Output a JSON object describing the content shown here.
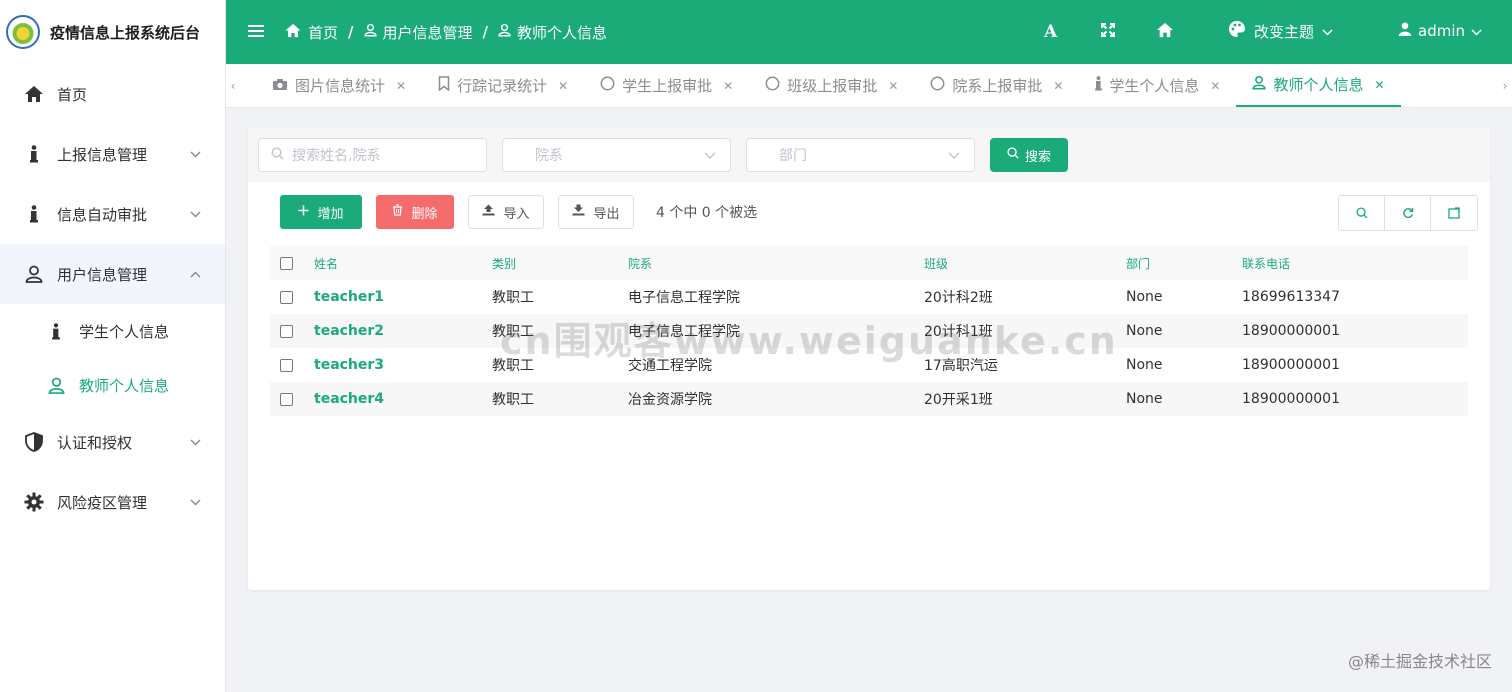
{
  "app": {
    "title": "疫情信息上报系统后台"
  },
  "sidebar": {
    "items": [
      {
        "label": "首页"
      },
      {
        "label": "上报信息管理"
      },
      {
        "label": "信息自动审批"
      },
      {
        "label": "用户信息管理"
      },
      {
        "label": "认证和授权"
      },
      {
        "label": "风险疫区管理"
      }
    ],
    "sub_items": [
      {
        "label": "学生个人信息"
      },
      {
        "label": "教师个人信息"
      }
    ]
  },
  "header": {
    "breadcrumb": [
      "首页",
      "用户信息管理",
      "教师个人信息"
    ],
    "font_label": "A",
    "theme_label": "改变主题",
    "user_label": "admin"
  },
  "tabs": [
    {
      "label": "图片信息统计",
      "icon": "camera-icon"
    },
    {
      "label": "行踪记录统计",
      "icon": "bookmark-icon"
    },
    {
      "label": "学生上报审批",
      "icon": "circle-icon"
    },
    {
      "label": "班级上报审批",
      "icon": "circle-icon"
    },
    {
      "label": "院系上报审批",
      "icon": "circle-icon"
    },
    {
      "label": "学生个人信息",
      "icon": "info-icon"
    },
    {
      "label": "教师个人信息",
      "icon": "user-icon"
    }
  ],
  "filters": {
    "search_placeholder": "搜索姓名,院系",
    "college_placeholder": "院系",
    "dept_placeholder": "部门",
    "search_button": "搜索"
  },
  "toolbar": {
    "add_label": "增加",
    "delete_label": "删除",
    "import_label": "导入",
    "export_label": "导出",
    "selection_status": "4 个中 0 个被选"
  },
  "table": {
    "columns": [
      "姓名",
      "类别",
      "院系",
      "班级",
      "部门",
      "联系电话"
    ],
    "rows": [
      [
        "teacher1",
        "教职工",
        "电子信息工程学院",
        "20计科2班",
        "None",
        "18699613347"
      ],
      [
        "teacher2",
        "教职工",
        "电子信息工程学院",
        "20计科1班",
        "None",
        "18900000001"
      ],
      [
        "teacher3",
        "教职工",
        "交通工程学院",
        "17高职汽运",
        "None",
        "18900000001"
      ],
      [
        "teacher4",
        "教职工",
        "冶金资源学院",
        "20开采1班",
        "None",
        "18900000001"
      ]
    ]
  },
  "watermark": "cn围观客www.weiguanke.cn",
  "footer_mark": "@稀土掘金技术社区",
  "colors": {
    "accent": "#1aab78",
    "danger": "#f56c6c"
  }
}
